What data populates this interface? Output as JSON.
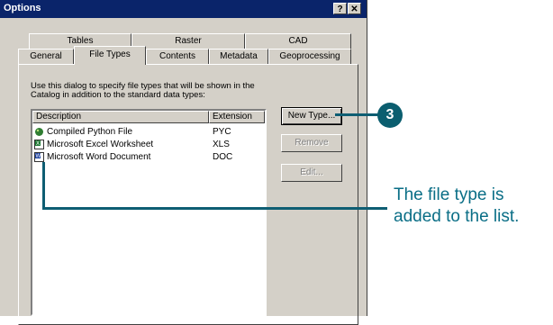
{
  "dialog": {
    "title": "Options",
    "help_btn": "?",
    "close_btn": "✕"
  },
  "tabs_row1": [
    "Tables",
    "Raster",
    "CAD"
  ],
  "tabs_row2": [
    "General",
    "File Types",
    "Contents",
    "Metadata",
    "Geoprocessing"
  ],
  "active_tab": "File Types",
  "instructions": "Use this dialog to specify file types that will be shown in the Catalog in addition to the standard data types:",
  "list": {
    "col_description": "Description",
    "col_extension": "Extension",
    "rows": [
      {
        "description": "Compiled Python File",
        "extension": "PYC",
        "icon": "python-file-icon"
      },
      {
        "description": "Microsoft Excel Worksheet",
        "extension": "XLS",
        "icon": "excel-file-icon"
      },
      {
        "description": "Microsoft Word Document",
        "extension": "DOC",
        "icon": "word-file-icon"
      }
    ]
  },
  "buttons": {
    "new_type": "New Type...",
    "remove": "Remove",
    "edit": "Edit..."
  },
  "callout": {
    "step": "3",
    "caption": "The file type is added to the list.",
    "color": "#0b5e6f"
  }
}
